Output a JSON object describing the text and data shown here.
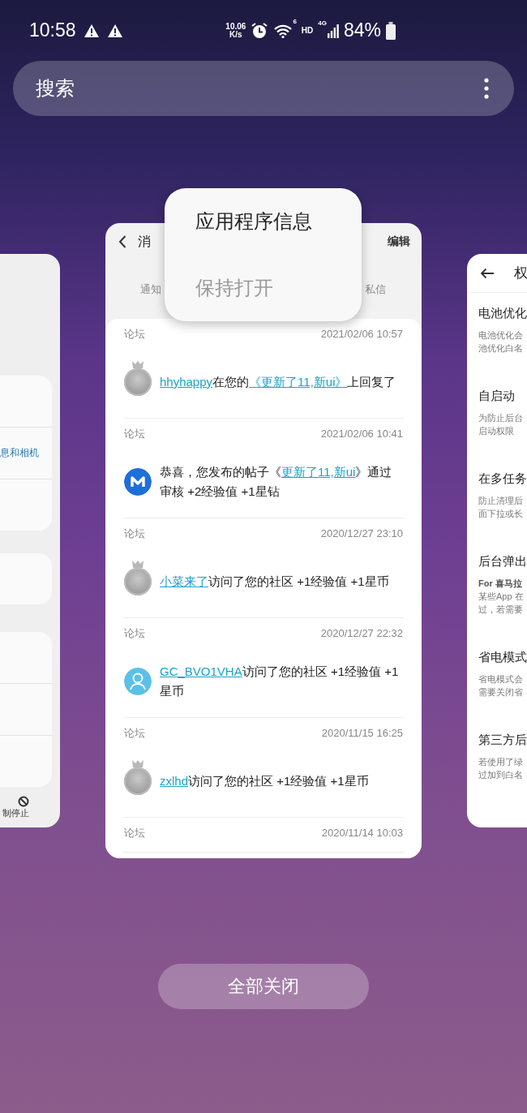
{
  "status_bar": {
    "time": "10:58",
    "notification_icons": [
      {
        "kind": "warning"
      },
      {
        "kind": "warning"
      }
    ],
    "net_speed": {
      "value": "10.06",
      "unit": "K/s"
    },
    "wifi_badge": "6",
    "hd": "HD",
    "network_type": "4G",
    "battery": "84%"
  },
  "search": {
    "placeholder": "搜索"
  },
  "left_card": {
    "link_text": "息和相机",
    "action": "制停止"
  },
  "center_card": {
    "title": "消",
    "action": "编辑",
    "tabs": [
      {
        "label": "通知",
        "selected": false
      },
      {
        "label": "私信",
        "selected": false
      }
    ],
    "popup": {
      "items": [
        {
          "label": "应用程序信息",
          "disabled": false
        },
        {
          "label": "保持打开",
          "disabled": true
        }
      ]
    },
    "messages": [
      {
        "category": "论坛",
        "time": "2021/02/06 10:57",
        "avatar": {
          "kind": "picture"
        },
        "crown": true,
        "text": [
          {
            "text": "hhyhappy",
            "link": true
          },
          {
            "text": "在您的",
            "link": false
          },
          {
            "text": "《更新了11,新ui》",
            "link": true
          },
          {
            "text": "上回复了",
            "link": false
          }
        ]
      },
      {
        "category": "论坛",
        "time": "2021/02/06 10:41",
        "avatar": {
          "kind": "logo"
        },
        "crown": false,
        "text": [
          {
            "text": "恭喜，您发布的帖子《",
            "link": false
          },
          {
            "text": "更新了11,新ui",
            "link": true
          },
          {
            "text": "》通过审核 +2经验值 +1星钻",
            "link": false
          }
        ]
      },
      {
        "category": "论坛",
        "time": "2020/12/27 23:10",
        "avatar": {
          "kind": "picture"
        },
        "crown": true,
        "text": [
          {
            "text": "小菜来了",
            "link": true
          },
          {
            "text": "访问了您的社区 +1经验值 +1星币",
            "link": false
          }
        ]
      },
      {
        "category": "论坛",
        "time": "2020/12/27 22:32",
        "avatar": {
          "kind": "person"
        },
        "crown": false,
        "text": [
          {
            "text": "GC_BVO1VHA",
            "link": true
          },
          {
            "text": "访问了您的社区 +1经验值 +1星币",
            "link": false
          }
        ]
      },
      {
        "category": "论坛",
        "time": "2020/11/15 16:25",
        "avatar": {
          "kind": "picture"
        },
        "crown": true,
        "text": [
          {
            "text": "zxlhd",
            "link": true
          },
          {
            "text": "访问了您的社区 +1经验值 +1星币",
            "link": false
          }
        ]
      },
      {
        "category": "论坛",
        "time": "2020/11/14 10:03"
      }
    ]
  },
  "right_card": {
    "title": "权",
    "sections": [
      {
        "title": "电池优化",
        "description": "电池优化会池优化白名"
      },
      {
        "title": "自启动",
        "description": "为防止后台启动权限"
      },
      {
        "title": "在多任务",
        "description": "防止清理后面下拉或长"
      },
      {
        "title": "后台弹出",
        "description": "**For 喜马拉**某些App 在过，若需要"
      },
      {
        "title": "省电模式",
        "description": "省电模式会需要关闭省"
      },
      {
        "title": "第三方后",
        "description": "若使用了绿过加到白名"
      }
    ]
  },
  "close_all": "全部关闭"
}
